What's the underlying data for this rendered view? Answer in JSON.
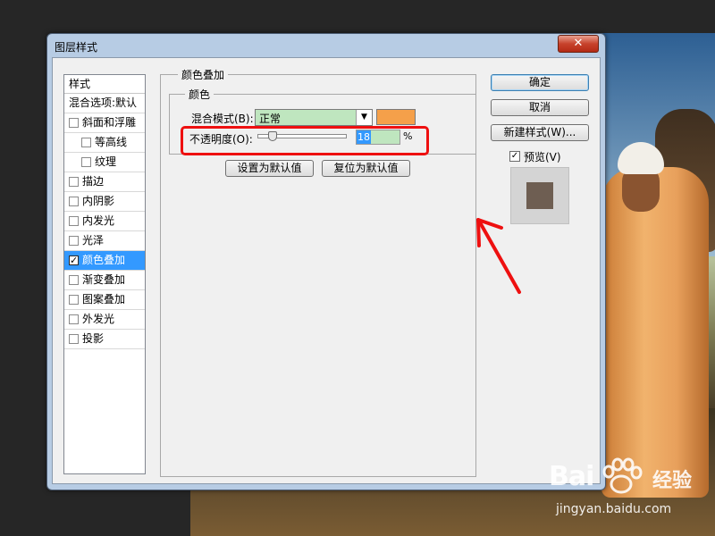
{
  "dialog": {
    "title": "图层样式",
    "close_label": "✕"
  },
  "style_list": {
    "header": "样式",
    "items": [
      {
        "label": "混合选项:默认",
        "checkbox": false,
        "checked": false,
        "sub": false,
        "selected": false
      },
      {
        "label": "斜面和浮雕",
        "checkbox": true,
        "checked": false,
        "sub": false,
        "selected": false
      },
      {
        "label": "等高线",
        "checkbox": true,
        "checked": false,
        "sub": true,
        "selected": false
      },
      {
        "label": "纹理",
        "checkbox": true,
        "checked": false,
        "sub": true,
        "selected": false
      },
      {
        "label": "描边",
        "checkbox": true,
        "checked": false,
        "sub": false,
        "selected": false
      },
      {
        "label": "内阴影",
        "checkbox": true,
        "checked": false,
        "sub": false,
        "selected": false
      },
      {
        "label": "内发光",
        "checkbox": true,
        "checked": false,
        "sub": false,
        "selected": false
      },
      {
        "label": "光泽",
        "checkbox": true,
        "checked": false,
        "sub": false,
        "selected": false
      },
      {
        "label": "颜色叠加",
        "checkbox": true,
        "checked": true,
        "sub": false,
        "selected": true
      },
      {
        "label": "渐变叠加",
        "checkbox": true,
        "checked": false,
        "sub": false,
        "selected": false
      },
      {
        "label": "图案叠加",
        "checkbox": true,
        "checked": false,
        "sub": false,
        "selected": false
      },
      {
        "label": "外发光",
        "checkbox": true,
        "checked": false,
        "sub": false,
        "selected": false
      },
      {
        "label": "投影",
        "checkbox": true,
        "checked": false,
        "sub": false,
        "selected": false
      }
    ]
  },
  "panel": {
    "group_title": "颜色叠加",
    "subgroup_title": "颜色",
    "blend_mode_label": "混合模式(B):",
    "blend_mode_value": "正常",
    "swatch_color": "#f5a04a",
    "opacity_label": "不透明度(O):",
    "opacity_value": "18",
    "opacity_unit": "%",
    "set_default_label": "设置为默认值",
    "reset_default_label": "复位为默认值"
  },
  "actions": {
    "ok_label": "确定",
    "cancel_label": "取消",
    "new_style_label": "新建样式(W)...",
    "preview_label": "预览(V)",
    "preview_checked": true,
    "preview_color": "#6e5e52"
  },
  "colors": {
    "accent_selection": "#3399ff",
    "annotation_red": "#ee1010"
  },
  "watermark": {
    "logo": "Bai",
    "brand_cn": "经验",
    "url": "jingyan.baidu.com"
  }
}
